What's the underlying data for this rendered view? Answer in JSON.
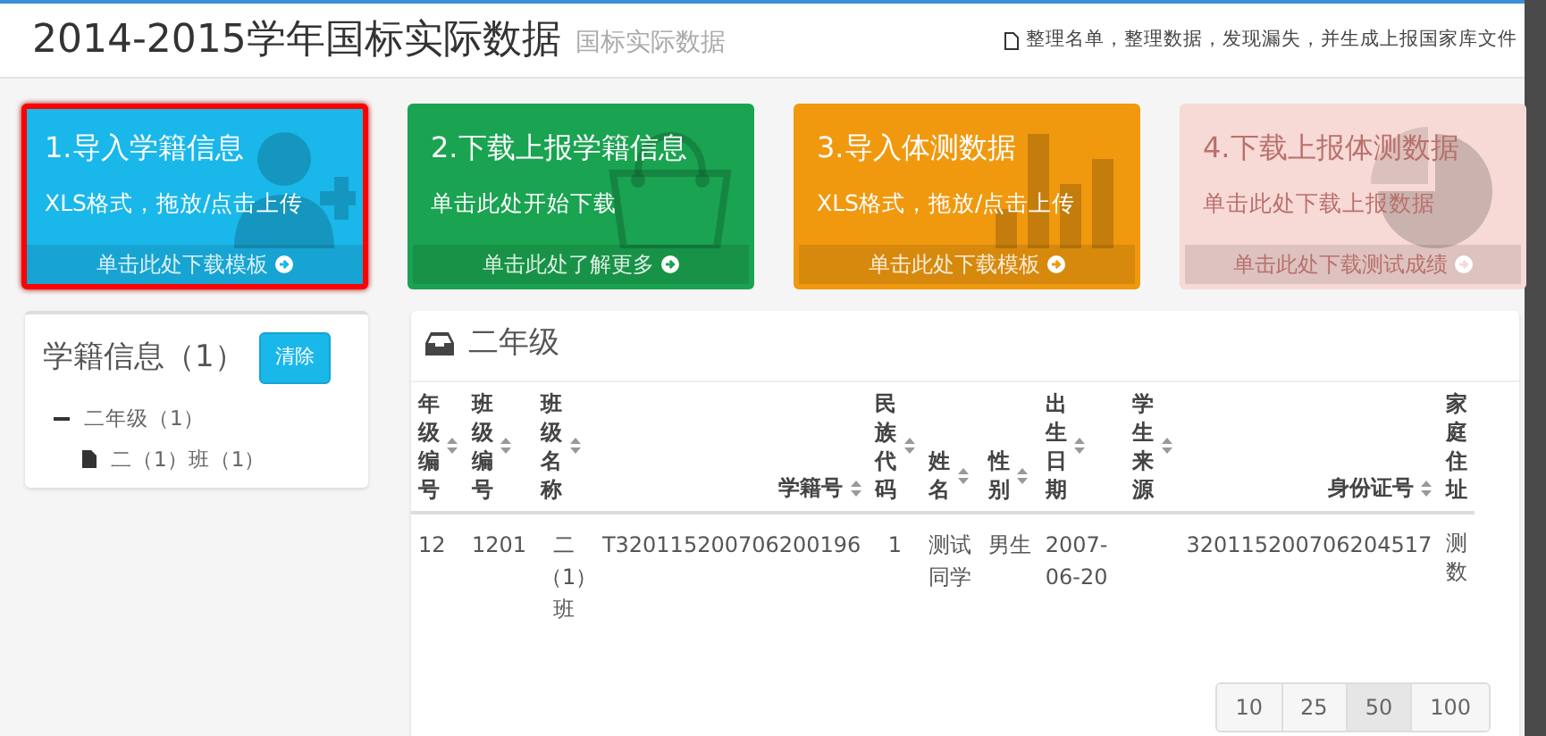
{
  "header": {
    "title": "2014-2015学年国标实际数据",
    "subtitle": "国标实际数据",
    "note": "整理名单，整理数据，发现漏失，并生成上报国家库文件"
  },
  "tiles": [
    {
      "title": "1.导入学籍信息",
      "subtitle": "XLS格式，拖放/点击上传",
      "footer": "单击此处下载模板",
      "color": "#1ab7ea",
      "kind": "user",
      "selected": true,
      "disabled": false
    },
    {
      "title": "2.下载上报学籍信息",
      "subtitle": "单击此处开始下载",
      "footer": "单击此处了解更多",
      "color": "#1aa350",
      "kind": "bag",
      "selected": false,
      "disabled": false
    },
    {
      "title": "3.导入体测数据",
      "subtitle": "XLS格式，拖放/点击上传",
      "footer": "单击此处下载模板",
      "color": "#f0990f",
      "kind": "chart",
      "selected": false,
      "disabled": false
    },
    {
      "title": "4.下载上报体测数据",
      "subtitle": "单击此处下载上报数据",
      "footer": "单击此处下载测试成绩",
      "color": "#f7d9d6",
      "kind": "pie",
      "selected": false,
      "disabled": true
    }
  ],
  "sidebar": {
    "title": "学籍信息（1）",
    "clear_button": "清除",
    "tree": [
      {
        "label": "二年级（1）",
        "expanded": true,
        "children": [
          {
            "label": "二（1）班（1）"
          }
        ]
      }
    ]
  },
  "table": {
    "title": "二年级",
    "columns": [
      {
        "label": "年级编号",
        "sortable": true
      },
      {
        "label": "班级编号",
        "sortable": true
      },
      {
        "label": "班级名称",
        "sortable": true
      },
      {
        "label": "学籍号",
        "sortable": true
      },
      {
        "label": "民族代码",
        "sortable": true
      },
      {
        "label": "姓名",
        "sortable": true
      },
      {
        "label": "性别",
        "sortable": true
      },
      {
        "label": "出生日期",
        "sortable": true
      },
      {
        "label": "学生来源",
        "sortable": true
      },
      {
        "label": "身份证号",
        "sortable": true
      },
      {
        "label": "家庭住址"
      }
    ],
    "rows": [
      [
        "12",
        "1201",
        "二（1）班",
        "T320115200706200196",
        "1",
        "测试同学",
        "男生",
        "2007-06-20",
        "",
        "320115200706204517",
        "测数"
      ]
    ],
    "page_sizes": [
      {
        "label": "10",
        "selected": false
      },
      {
        "label": "25",
        "selected": false
      },
      {
        "label": "50",
        "selected": true
      },
      {
        "label": "100",
        "selected": false
      }
    ]
  }
}
